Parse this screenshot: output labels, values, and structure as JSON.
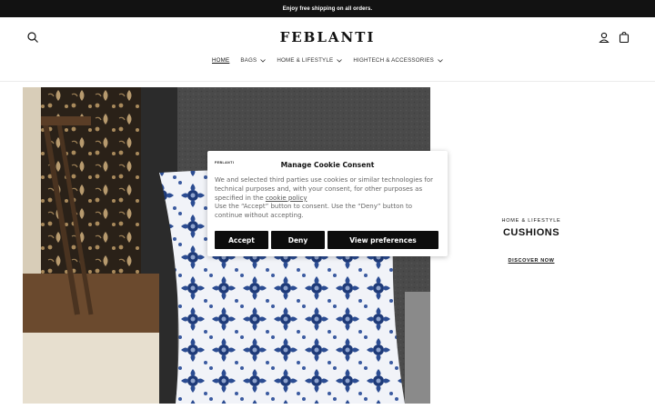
{
  "announcement": "Enjoy free shipping on all orders.",
  "brand": "FEBLANTI",
  "nav": [
    {
      "label": "HOME",
      "dropdown": false
    },
    {
      "label": "BAGS",
      "dropdown": true
    },
    {
      "label": "HOME & LIFESTYLE",
      "dropdown": true
    },
    {
      "label": "HIGHTECH & ACCESSORIES",
      "dropdown": true
    }
  ],
  "promo": {
    "kicker": "HOME & LIFESTYLE",
    "title": "CUSHIONS",
    "cta": "DISCOVER NOW"
  },
  "consent": {
    "logo_text": "FEBLANTI",
    "title": "Manage Cookie Consent",
    "body_1": "We and selected third parties use cookies or similar technologies for technical purposes and, with your consent, for other purposes as specified in the ",
    "policy_link": "cookie policy",
    "body_2": "Use the “Accept” button to consent. Use the “Deny” button to continue without accepting.",
    "accept": "Accept",
    "deny": "Deny",
    "preferences": "View preferences"
  },
  "colors": {
    "dark": "#121212",
    "navy": "#1e3a78"
  }
}
